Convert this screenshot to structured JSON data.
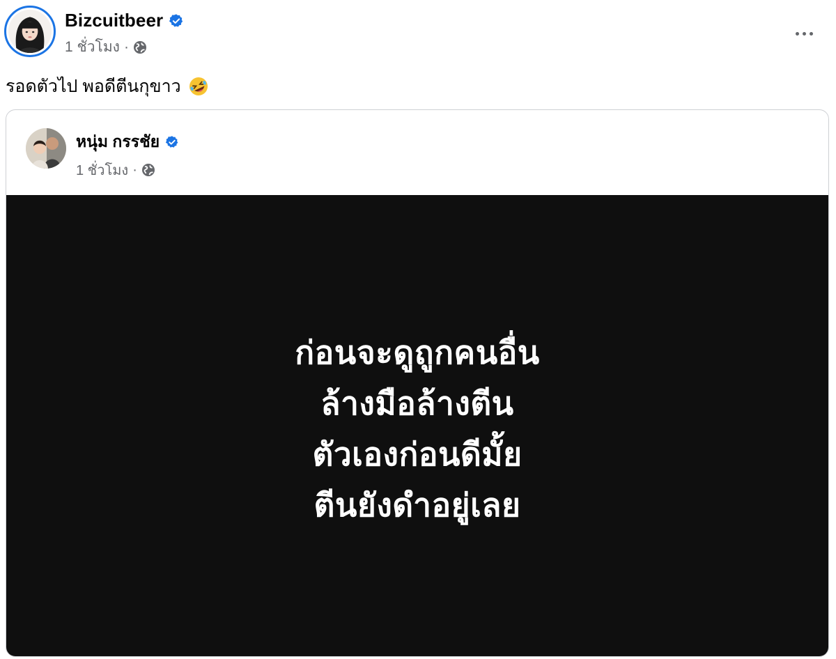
{
  "post": {
    "author": "Bizcuitbeer",
    "time": "1 ชั่วโมง",
    "separator": "·",
    "caption": "รอดตัวไป พอดีตีนกุขาว"
  },
  "shared_post": {
    "author": "หนุ่ม กรรชัย",
    "time": "1 ชั่วโมง",
    "separator": "·",
    "text_lines": [
      "ก่อนจะดูถูกคนอื่น",
      "ล้างมือล้างตีน",
      "ตัวเองก่อนดีมั้ย",
      "ตีนยังดำอยู่เลย"
    ]
  },
  "colors": {
    "verified": "#1b74e4",
    "meta_text": "#65676b",
    "post_background": "#0f0f0f"
  },
  "icons": {
    "verified": "verified-badge-icon",
    "audience": "globe-icon",
    "more": "more-options-icon",
    "emoji": "rolling-on-floor-laughing-emoji"
  }
}
